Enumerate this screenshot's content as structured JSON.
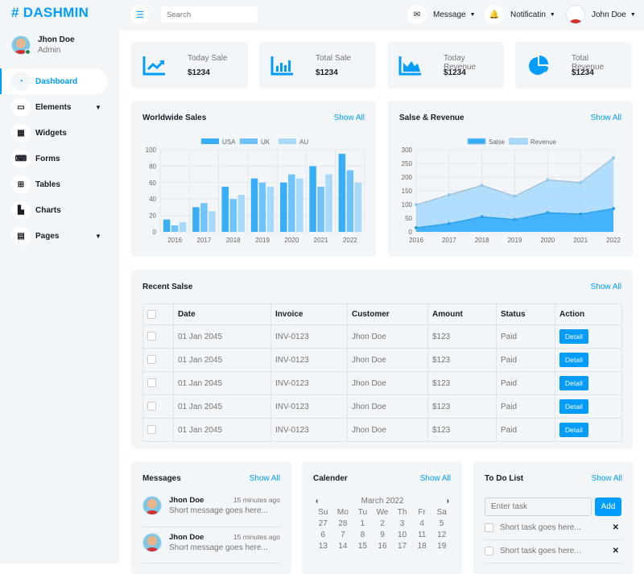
{
  "brand": {
    "logo": "# DASHMIN",
    "accent": "#009cff"
  },
  "sidebar": {
    "user": {
      "name": "Jhon Doe",
      "role": "Admin"
    },
    "items": [
      {
        "label": "Dashboard",
        "icon": "dashboard-gauge-icon",
        "active": true
      },
      {
        "label": "Elements",
        "icon": "laptop-icon",
        "chevron": true
      },
      {
        "label": "Widgets",
        "icon": "grid-icon"
      },
      {
        "label": "Forms",
        "icon": "keyboard-icon"
      },
      {
        "label": "Tables",
        "icon": "table-icon"
      },
      {
        "label": "Charts",
        "icon": "chart-icon"
      },
      {
        "label": "Pages",
        "icon": "file-icon",
        "chevron": true
      }
    ]
  },
  "topbar": {
    "search_placeholder": "Search",
    "message": "Message",
    "notification": "Notificatin",
    "user": "John Doe"
  },
  "stats": [
    {
      "label": "Today Sale",
      "value": "$1234",
      "icon": "line-chart-icon"
    },
    {
      "label": "Total Sale",
      "value": "$1234",
      "icon": "bar-chart-icon"
    },
    {
      "label": "Today Revenue",
      "value": "$1234",
      "icon": "area-chart-icon"
    },
    {
      "label": "Total Revenue",
      "value": "$1234",
      "icon": "pie-chart-icon"
    }
  ],
  "show_all": "Show All",
  "chart_data": [
    {
      "type": "bar",
      "title": "Worldwide Sales",
      "categories": [
        "2016",
        "2017",
        "2018",
        "2019",
        "2020",
        "2021",
        "2022"
      ],
      "series": [
        {
          "name": "USA",
          "values": [
            15,
            30,
            55,
            65,
            60,
            80,
            95
          ],
          "color": "#39aef8"
        },
        {
          "name": "UK",
          "values": [
            8,
            35,
            40,
            60,
            70,
            55,
            75
          ],
          "color": "#6fc3fa"
        },
        {
          "name": "AU",
          "values": [
            12,
            25,
            45,
            55,
            65,
            70,
            60
          ],
          "color": "#a6d9fc"
        }
      ],
      "ylim": [
        0,
        100
      ],
      "yticks": [
        0,
        20,
        40,
        60,
        80,
        100
      ],
      "grid": true,
      "legend": "top"
    },
    {
      "type": "area",
      "title": "Salse & Revenue",
      "categories": [
        "2016",
        "2017",
        "2018",
        "2019",
        "2020",
        "2021",
        "2022"
      ],
      "series": [
        {
          "name": "Salse",
          "values": [
            15,
            30,
            55,
            45,
            70,
            65,
            85
          ],
          "color": "#39aef8"
        },
        {
          "name": "Revenue",
          "values": [
            99,
            135,
            170,
            130,
            190,
            180,
            270
          ],
          "color": "#a6d9fc"
        }
      ],
      "ylim": [
        0,
        300
      ],
      "yticks": [
        0,
        50,
        100,
        150,
        200,
        250,
        300
      ],
      "grid": true,
      "legend": "top"
    }
  ],
  "recent": {
    "title": "Recent Salse",
    "headers": [
      "Date",
      "Invoice",
      "Customer",
      "Amount",
      "Status",
      "Action"
    ],
    "rows": [
      {
        "date": "01 Jan 2045",
        "invoice": "INV-0123",
        "customer": "Jhon Doe",
        "amount": "$123",
        "status": "Paid",
        "action": "Detail"
      },
      {
        "date": "01 Jan 2045",
        "invoice": "INV-0123",
        "customer": "Jhon Doe",
        "amount": "$123",
        "status": "Paid",
        "action": "Detail"
      },
      {
        "date": "01 Jan 2045",
        "invoice": "INV-0123",
        "customer": "Jhon Doe",
        "amount": "$123",
        "status": "Paid",
        "action": "Detail"
      },
      {
        "date": "01 Jan 2045",
        "invoice": "INV-0123",
        "customer": "Jhon Doe",
        "amount": "$123",
        "status": "Paid",
        "action": "Detail"
      },
      {
        "date": "01 Jan 2045",
        "invoice": "INV-0123",
        "customer": "Jhon Doe",
        "amount": "$123",
        "status": "Paid",
        "action": "Detail"
      }
    ]
  },
  "messages": {
    "title": "Messages",
    "items": [
      {
        "name": "Jhon Doe",
        "time": "15 minutes ago",
        "text": "Short message goes here..."
      },
      {
        "name": "Jhon Doe",
        "time": "15 minutes ago",
        "text": "Short message goes here..."
      }
    ]
  },
  "calendar": {
    "title": "Calender",
    "month": "March 2022",
    "days": [
      "Su",
      "Mo",
      "Tu",
      "We",
      "Th",
      "Fr",
      "Sa"
    ],
    "dates": [
      "27",
      "28",
      "1",
      "2",
      "3",
      "4",
      "5",
      "6",
      "7",
      "8",
      "9",
      "10",
      "11",
      "12",
      "13",
      "14",
      "15",
      "16",
      "17",
      "18",
      "19"
    ]
  },
  "todo": {
    "title": "To Do List",
    "placeholder": "Enter task",
    "add": "Add",
    "tasks": [
      "Short task goes here...",
      "Short task goes here..."
    ]
  }
}
